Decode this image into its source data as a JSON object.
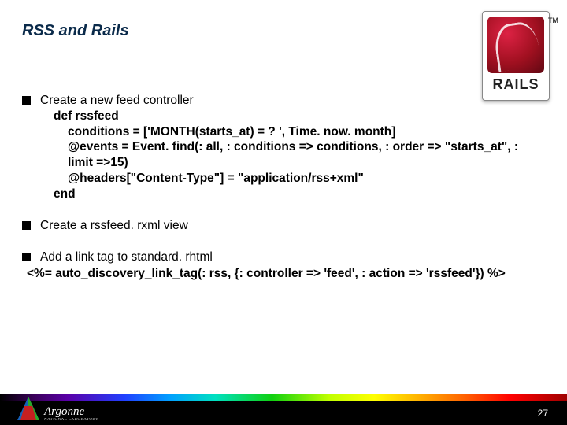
{
  "title": "RSS and Rails",
  "logo": {
    "label": "RAILS",
    "tm": "TM"
  },
  "bullets": {
    "b1": "Create a new feed controller",
    "b2": "Create a rssfeed. rxml view",
    "b3": "Add a link tag to standard. rhtml"
  },
  "code": {
    "l1": "def rssfeed",
    "l2": "conditions = ['MONTH(starts_at) = ? ', Time. now. month]",
    "l3": "@events = Event. find(: all, : conditions => conditions, : order => \"starts_at\", : limit =>15)",
    "l4": "@headers[\"Content-Type\"] = \"application/rss+xml\"",
    "l5": "end"
  },
  "erb": "<%= auto_discovery_link_tag(: rss, {: controller => 'feed', : action => 'rssfeed'}) %>",
  "footer": {
    "org": "Argonne",
    "org_sub": "NATIONAL LABORATORY",
    "page": "27"
  }
}
